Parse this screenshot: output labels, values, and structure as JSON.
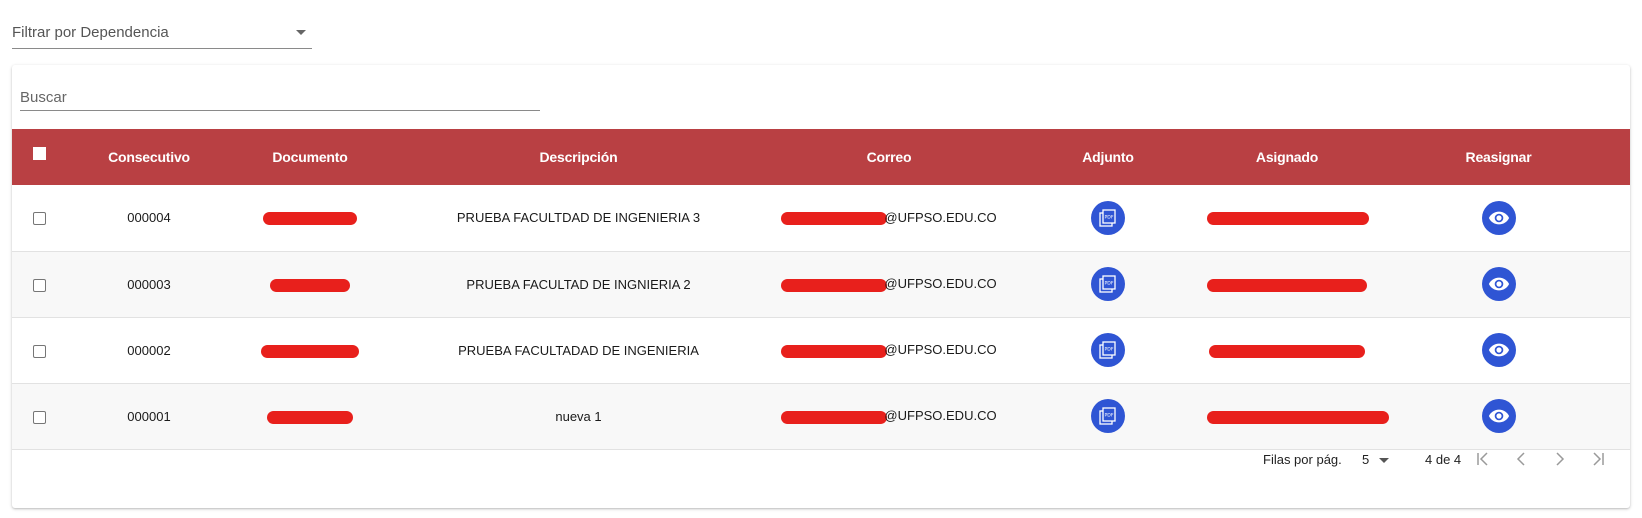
{
  "filter": {
    "label": "Filtrar por Dependencia"
  },
  "search": {
    "placeholder": "Buscar"
  },
  "table": {
    "headers": {
      "consecutivo": "Consecutivo",
      "documento": "Documento",
      "descripcion": "Descripción",
      "correo": "Correo",
      "adjunto": "Adjunto",
      "asignado": "Asignado",
      "reasignar": "Reasignar"
    },
    "rows": [
      {
        "consecutivo": "000004",
        "descripcion": "PRUEBA FACULTDAD DE INGENIERIA 3",
        "correo_visible": "@UFPSO.EDU.CO"
      },
      {
        "consecutivo": "000003",
        "descripcion": "PRUEBA FACULTAD DE INGNIERIA 2",
        "correo_visible": "@UFPSO.EDU.CO"
      },
      {
        "consecutivo": "000002",
        "descripcion": "PRUEBA FACULTADAD DE INGENIERIA",
        "correo_visible": "@UFPSO.EDU.CO"
      },
      {
        "consecutivo": "000001",
        "descripcion": "nueva 1",
        "correo_visible": "@UFPSO.EDU.CO"
      }
    ]
  },
  "pagination": {
    "rows_per_page_label": "Filas por pág.",
    "rows_per_page_value": "5",
    "page_info": "4 de 4"
  },
  "colors": {
    "header_bg": "#b94043",
    "action_button": "#2f55d4",
    "redaction": "#e8201c"
  },
  "icons": {
    "attachment": "pdf-icon",
    "reassign": "eye-icon",
    "dropdown": "chevron-down-icon",
    "first_page": "first-page-icon",
    "prev_page": "chevron-left-icon",
    "next_page": "chevron-right-icon",
    "last_page": "last-page-icon"
  }
}
